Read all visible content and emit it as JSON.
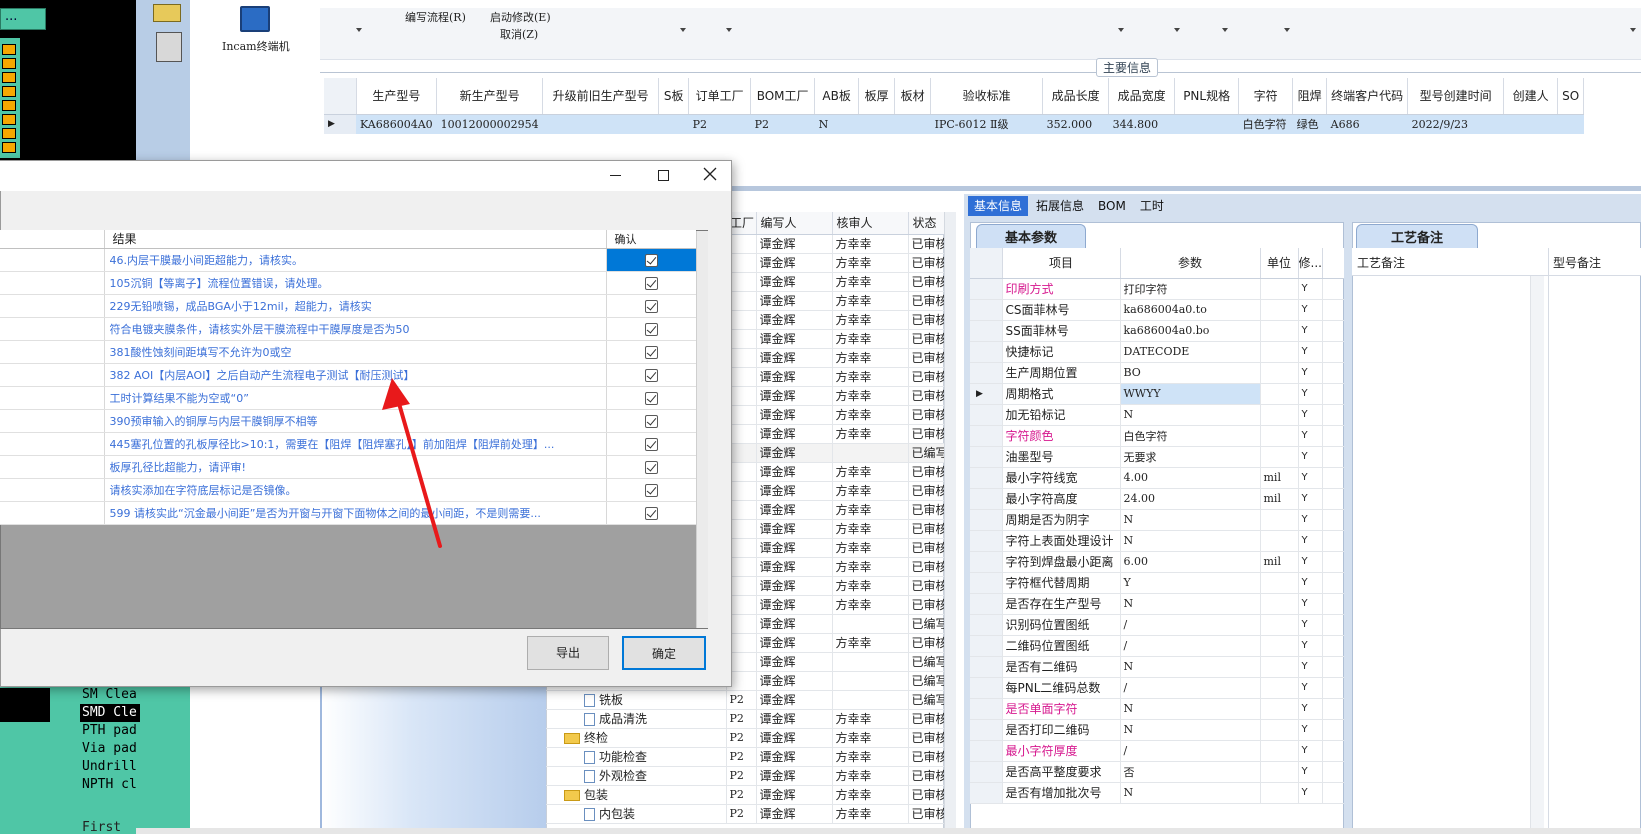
{
  "left_app": {
    "incam_label": "Incam终端机",
    "ellipsis": "...",
    "menu_items": [
      "SM Clea",
      "SMD Cle",
      "PTH pad",
      "Via pad",
      "Undrill",
      "NPTH cl"
    ],
    "first_label": "First"
  },
  "toolbar": {
    "menu1": "编写流程(R)",
    "menu2": "启动修改(E)",
    "menu3": "取消(Z)"
  },
  "main_info": {
    "section_title": "主要信息",
    "columns": [
      "生产型号",
      "新生产型号",
      "升级前旧生产型号",
      "S板",
      "订单工厂",
      "BOM工厂",
      "AB板",
      "板厚",
      "板材",
      "验收标准",
      "成品长度",
      "成品宽度",
      "PNL规格",
      "字符",
      "阻焊",
      "终端客户代码",
      "型号创建时间",
      "创建人",
      "SO"
    ],
    "row": [
      "KA686004A0",
      "10012000002954",
      "",
      "",
      "P2",
      "P2",
      "N",
      "",
      "",
      "IPC-6012 Ⅱ级",
      "352.000",
      "344.800",
      "",
      "白色字符",
      "绿色",
      "A686",
      "2022/9/23",
      "",
      ""
    ]
  },
  "process_table": {
    "columns": [
      "工厂",
      "编写人",
      "核审人",
      "状态"
    ],
    "rows": [
      {
        "tree": "",
        "factory": "",
        "writer": "谭金辉",
        "reviewer": "方幸幸",
        "status": "已审核"
      },
      {
        "tree": "",
        "factory": "",
        "writer": "谭金辉",
        "reviewer": "方幸幸",
        "status": "已审核"
      },
      {
        "tree": "",
        "factory": "",
        "writer": "谭金辉",
        "reviewer": "方幸幸",
        "status": "已审核"
      },
      {
        "tree": "",
        "factory": "",
        "writer": "谭金辉",
        "reviewer": "方幸幸",
        "status": "已审核"
      },
      {
        "tree": "",
        "factory": "",
        "writer": "谭金辉",
        "reviewer": "方幸幸",
        "status": "已审核"
      },
      {
        "tree": "",
        "factory": "",
        "writer": "谭金辉",
        "reviewer": "方幸幸",
        "status": "已审核"
      },
      {
        "tree": "",
        "factory": "",
        "writer": "谭金辉",
        "reviewer": "方幸幸",
        "status": "已审核"
      },
      {
        "tree": "",
        "factory": "",
        "writer": "谭金辉",
        "reviewer": "方幸幸",
        "status": "已审核"
      },
      {
        "tree": "",
        "factory": "",
        "writer": "谭金辉",
        "reviewer": "方幸幸",
        "status": "已审核"
      },
      {
        "tree": "",
        "factory": "",
        "writer": "谭金辉",
        "reviewer": "方幸幸",
        "status": "已审核"
      },
      {
        "tree": "",
        "factory": "",
        "writer": "谭金辉",
        "reviewer": "方幸幸",
        "status": "已审核"
      },
      {
        "tree": "",
        "factory": "",
        "writer": "谭金辉",
        "reviewer": "",
        "status": "已编写"
      },
      {
        "tree": "",
        "factory": "",
        "writer": "谭金辉",
        "reviewer": "方幸幸",
        "status": "已审核"
      },
      {
        "tree": "",
        "factory": "",
        "writer": "谭金辉",
        "reviewer": "方幸幸",
        "status": "已审核"
      },
      {
        "tree": "",
        "factory": "",
        "writer": "谭金辉",
        "reviewer": "方幸幸",
        "status": "已审核"
      },
      {
        "tree": "",
        "factory": "",
        "writer": "谭金辉",
        "reviewer": "方幸幸",
        "status": "已审核"
      },
      {
        "tree": "",
        "factory": "",
        "writer": "谭金辉",
        "reviewer": "方幸幸",
        "status": "已审核"
      },
      {
        "tree": "",
        "factory": "",
        "writer": "谭金辉",
        "reviewer": "方幸幸",
        "status": "已审核"
      },
      {
        "tree": "",
        "factory": "",
        "writer": "谭金辉",
        "reviewer": "方幸幸",
        "status": "已审核"
      },
      {
        "tree": "",
        "factory": "",
        "writer": "谭金辉",
        "reviewer": "方幸幸",
        "status": "已审核"
      },
      {
        "tree": "",
        "factory": "",
        "writer": "谭金辉",
        "reviewer": "",
        "status": "已编写"
      },
      {
        "tree": "",
        "factory": "",
        "writer": "谭金辉",
        "reviewer": "方幸幸",
        "status": "已审核"
      },
      {
        "tree": "",
        "factory": "",
        "writer": "谭金辉",
        "reviewer": "",
        "status": "已编写"
      },
      {
        "tree": "",
        "factory": "",
        "writer": "谭金辉",
        "reviewer": "",
        "status": "已编写"
      },
      {
        "tree": "铣板",
        "factory": "P2",
        "writer": "谭金辉",
        "reviewer": "",
        "status": "已编写"
      },
      {
        "tree": "成品清洗",
        "factory": "P2",
        "writer": "谭金辉",
        "reviewer": "方幸幸",
        "status": "已审核"
      },
      {
        "tree": "终检",
        "factory": "P2",
        "writer": "谭金辉",
        "reviewer": "方幸幸",
        "status": "已审核"
      },
      {
        "tree": "功能检查",
        "factory": "P2",
        "writer": "谭金辉",
        "reviewer": "方幸幸",
        "status": "已审核"
      },
      {
        "tree": "外观检查",
        "factory": "P2",
        "writer": "谭金辉",
        "reviewer": "方幸幸",
        "status": "已审核"
      },
      {
        "tree": "包装",
        "factory": "P2",
        "writer": "谭金辉",
        "reviewer": "方幸幸",
        "status": "已审核"
      },
      {
        "tree": "内包装",
        "factory": "P2",
        "writer": "谭金辉",
        "reviewer": "方幸幸",
        "status": "已审核"
      }
    ]
  },
  "detail_tabs": [
    "基本信息",
    "拓展信息",
    "BOM",
    "工时"
  ],
  "basic_params": {
    "tab_label": "基本参数",
    "columns": [
      "项目",
      "参数",
      "单位",
      "修..."
    ],
    "rows": [
      {
        "item": "印刷方式",
        "value": "打印字符",
        "unit": "",
        "mod": "Y",
        "pink": true
      },
      {
        "item": "CS面菲林号",
        "value": "ka686004a0.to",
        "unit": "",
        "mod": "Y",
        "pink": false
      },
      {
        "item": "SS面菲林号",
        "value": "ka686004a0.bo",
        "unit": "",
        "mod": "Y",
        "pink": false
      },
      {
        "item": "快捷标记",
        "value": "DATECODE",
        "unit": "",
        "mod": "Y",
        "pink": false
      },
      {
        "item": "生产周期位置",
        "value": "BO",
        "unit": "",
        "mod": "Y",
        "pink": false
      },
      {
        "item": "周期格式",
        "value": "WWYY",
        "unit": "",
        "mod": "Y",
        "pink": false
      },
      {
        "item": "加无铅标记",
        "value": "N",
        "unit": "",
        "mod": "Y",
        "pink": false
      },
      {
        "item": "字符颜色",
        "value": "白色字符",
        "unit": "",
        "mod": "Y",
        "pink": true
      },
      {
        "item": "油墨型号",
        "value": "无要求",
        "unit": "",
        "mod": "Y",
        "pink": false
      },
      {
        "item": "最小字符线宽",
        "value": "4.00",
        "unit": "mil",
        "mod": "Y",
        "pink": false
      },
      {
        "item": "最小字符高度",
        "value": "24.00",
        "unit": "mil",
        "mod": "Y",
        "pink": false
      },
      {
        "item": "周期是否为阴字",
        "value": "N",
        "unit": "",
        "mod": "Y",
        "pink": false
      },
      {
        "item": "字符上表面处理设计",
        "value": "N",
        "unit": "",
        "mod": "Y",
        "pink": false
      },
      {
        "item": "字符到焊盘最小距离",
        "value": "6.00",
        "unit": "mil",
        "mod": "Y",
        "pink": false
      },
      {
        "item": "字符框代替周期",
        "value": "Y",
        "unit": "",
        "mod": "Y",
        "pink": false
      },
      {
        "item": "是否存在生产型号",
        "value": "N",
        "unit": "",
        "mod": "Y",
        "pink": false
      },
      {
        "item": "识别码位置图纸",
        "value": "/",
        "unit": "",
        "mod": "Y",
        "pink": false
      },
      {
        "item": "二维码位置图纸",
        "value": "/",
        "unit": "",
        "mod": "Y",
        "pink": false
      },
      {
        "item": "是否有二维码",
        "value": "N",
        "unit": "",
        "mod": "Y",
        "pink": false
      },
      {
        "item": "每PNL二维码总数",
        "value": "/",
        "unit": "",
        "mod": "Y",
        "pink": false
      },
      {
        "item": "是否单面字符",
        "value": "N",
        "unit": "",
        "mod": "Y",
        "pink": true
      },
      {
        "item": "是否打印二维码",
        "value": "N",
        "unit": "",
        "mod": "Y",
        "pink": false
      },
      {
        "item": "最小字符厚度",
        "value": "/",
        "unit": "",
        "mod": "Y",
        "pink": true
      },
      {
        "item": "是否高平整度要求",
        "value": "否",
        "unit": "",
        "mod": "Y",
        "pink": false
      },
      {
        "item": "是否有增加批次号",
        "value": "N",
        "unit": "",
        "mod": "Y",
        "pink": false
      }
    ]
  },
  "process_notes": {
    "tab_label": "工艺备注",
    "col1": "工艺备注",
    "col2": "型号备注"
  },
  "dialog": {
    "col_result": "结果",
    "col_confirm": "确认",
    "rows": [
      "46.内层干膜最小间距超能力，请核实。",
      "105沉铜【等离子】流程位置错误，请处理。",
      "229无铅喷锡，成品BGA小于12mil，超能力，请核实",
      "符合电镀夹膜条件，请核实外层干膜流程中干膜厚度是否为50",
      "381酸性蚀刻间距填写不允许为0或空",
      "382 AOI【内层AOI】之后自动产生流程电子测试【耐压测试】",
      "工时计算结果不能为空或“0”",
      "390预审输入的铜厚与内层干膜铜厚不相等",
      "445塞孔位置的孔板厚径比>10:1，需要在【阻焊【阻焊塞孔】】前加阻焊【阻焊前处理】...",
      "板厚孔径比超能力，请评审!",
      "请核实添加在字符底层标记是否镜像。",
      "599 请核实此“沉金最小间距”是否为开窗与开窗下面物体之间的最小间距，不是则需要..."
    ],
    "export_label": "导出",
    "ok_label": "确定"
  },
  "colors": {
    "accent": "#0078d7",
    "pink": "#d6178e",
    "result_text": "#3a6fd8",
    "selected_row": "#cfe3f7",
    "teal": "#4fc6a6",
    "arrow": "#e8191b"
  }
}
